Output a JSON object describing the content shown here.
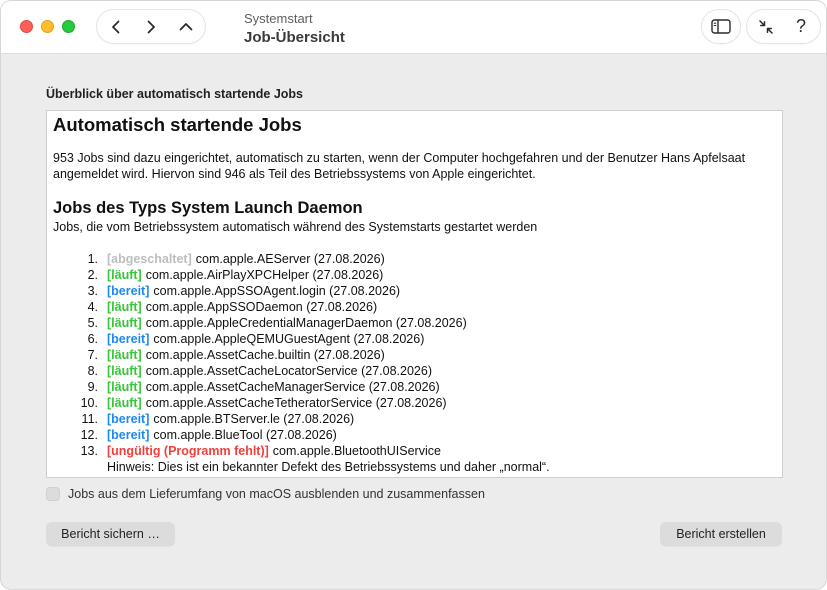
{
  "window": {
    "subtitle": "Systemstart",
    "title": "Job-Übersicht"
  },
  "colors": {
    "close": "#fe5f57",
    "minimize": "#febc2e",
    "maximize": "#28c840",
    "status_disabled": "#bdbdbd",
    "status_running": "#39c43a",
    "status_ready": "#1c8af0",
    "status_invalid": "#f0403d"
  },
  "toolbar": {
    "back_icon": "chevron-left-icon",
    "forward_icon": "chevron-right-icon",
    "up_icon": "chevron-up-icon",
    "sidebar_icon": "sidebar-icon",
    "collapse_icon": "collapse-arrows-icon",
    "help_label": "?"
  },
  "section_label": "Überblick über automatisch startende Jobs",
  "report": {
    "heading": "Automatisch startende Jobs",
    "summary": "953 Jobs sind dazu eingerichtet, automatisch zu starten, wenn der Computer hochgefahren und der Benutzer Hans Apfelsaat angemeldet wird. Hiervon sind 946 als Teil des Betriebssystems von Apple eingerichtet.",
    "subheading": "Jobs des Typs System Launch Daemon",
    "subheading_desc": "Jobs, die vom Betriebssystem automatisch während des Systemstarts gestartet werden",
    "jobs": [
      {
        "num": "1.",
        "status": "[abgeschaltet]",
        "kind": "disabled",
        "name": "com.apple.AEServer (27.08.2026)"
      },
      {
        "num": "2.",
        "status": "[läuft]",
        "kind": "running",
        "name": "com.apple.AirPlayXPCHelper (27.08.2026)"
      },
      {
        "num": "3.",
        "status": "[bereit]",
        "kind": "ready",
        "name": "com.apple.AppSSOAgent.login (27.08.2026)"
      },
      {
        "num": "4.",
        "status": "[läuft]",
        "kind": "running",
        "name": "com.apple.AppSSODaemon (27.08.2026)"
      },
      {
        "num": "5.",
        "status": "[läuft]",
        "kind": "running",
        "name": "com.apple.AppleCredentialManagerDaemon (27.08.2026)"
      },
      {
        "num": "6.",
        "status": "[bereit]",
        "kind": "ready",
        "name": "com.apple.AppleQEMUGuestAgent (27.08.2026)"
      },
      {
        "num": "7.",
        "status": "[läuft]",
        "kind": "running",
        "name": "com.apple.AssetCache.builtin (27.08.2026)"
      },
      {
        "num": "8.",
        "status": "[läuft]",
        "kind": "running",
        "name": "com.apple.AssetCacheLocatorService (27.08.2026)"
      },
      {
        "num": "9.",
        "status": "[läuft]",
        "kind": "running",
        "name": "com.apple.AssetCacheManagerService (27.08.2026)"
      },
      {
        "num": "10.",
        "status": "[läuft]",
        "kind": "running",
        "name": "com.apple.AssetCacheTetheratorService (27.08.2026)"
      },
      {
        "num": "11.",
        "status": "[bereit]",
        "kind": "ready",
        "name": "com.apple.BTServer.le (27.08.2026)"
      },
      {
        "num": "12.",
        "status": "[bereit]",
        "kind": "ready",
        "name": "com.apple.BlueTool (27.08.2026)"
      },
      {
        "num": "13.",
        "status": "[ungültig (Programm fehlt)]",
        "kind": "invalid",
        "name": "com.apple.BluetoothUIService"
      }
    ],
    "hint": "Hinweis: Dies ist ein bekannter Defekt des Betriebssystems und daher „normal“."
  },
  "checkbox": {
    "label": "Jobs aus dem Lieferumfang von macOS ausblenden und zusammenfassen",
    "checked": false
  },
  "buttons": {
    "save": "Bericht sichern …",
    "create": "Bericht erstellen"
  }
}
